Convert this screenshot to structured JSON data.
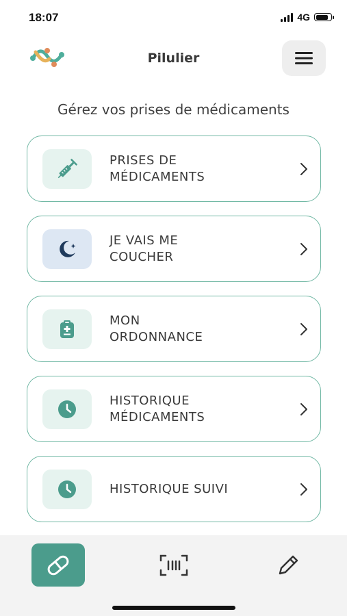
{
  "status": {
    "time": "18:07",
    "network": "4G"
  },
  "header": {
    "title": "Pilulier"
  },
  "subtitle": "Gérez vos prises de médicaments",
  "menu": [
    {
      "line1": "PRISES DE",
      "line2": "MÉDICAMENTS",
      "icon": "syringe-icon"
    },
    {
      "line1": "JE VAIS ME",
      "line2": "COUCHER",
      "icon": "moon-icon"
    },
    {
      "line1": "MON",
      "line2": "ORDONNANCE",
      "icon": "prescription-icon"
    },
    {
      "line1": "HISTORIQUE",
      "line2": "MÉDICAMENTS",
      "icon": "clock-icon"
    },
    {
      "line1": "HISTORIQUE SUIVI",
      "line2": "",
      "icon": "clock-icon"
    }
  ],
  "colors": {
    "accent": "#4b9c8c",
    "border": "#6fb7a3",
    "icon_bg_green": "#e6f3ef",
    "icon_bg_blue": "#dde7f3"
  }
}
